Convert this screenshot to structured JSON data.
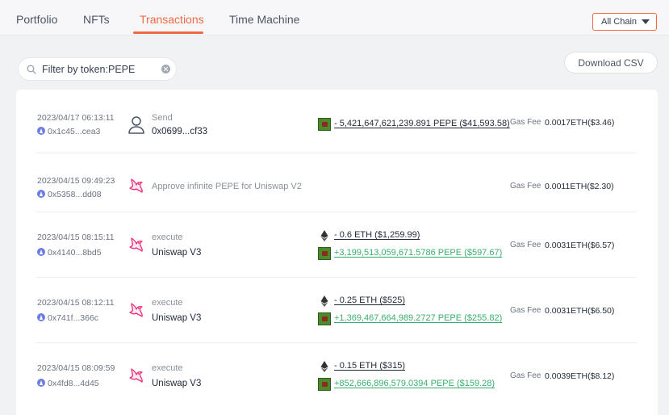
{
  "tabs": [
    {
      "label": "Portfolio"
    },
    {
      "label": "NFTs"
    },
    {
      "label": "Transactions"
    },
    {
      "label": "Time Machine"
    }
  ],
  "active_tab": "Transactions",
  "chain_select": {
    "value": "All Chain"
  },
  "filter": {
    "value": "Filter by token:PEPE"
  },
  "download_label": "Download CSV",
  "colors": {
    "accent": "#ef6a43",
    "positive": "#3aae6e"
  },
  "transactions": [
    {
      "time": "2023/04/17 06:13:11",
      "hash": "0x1c45...cea3",
      "type_icon": "user-icon",
      "type": "Send",
      "sub": "0x0699...cf33",
      "amounts": [
        {
          "token_icon": "pepe-token-icon",
          "text": "- 5,421,647,621,239.891 PEPE ($41,593.58)",
          "direction": "out"
        }
      ],
      "gas_label": "Gas Fee",
      "gas": "0.0017ETH($3.46)"
    },
    {
      "time": "2023/04/15 09:49:23",
      "hash": "0x5358...dd08",
      "type_icon": "uniswap-icon",
      "type": "Approve infinite PEPE for Uniswap V2",
      "sub": "",
      "amounts": [],
      "gas_label": "Gas Fee",
      "gas": "0.0011ETH($2.30)"
    },
    {
      "time": "2023/04/15 08:15:11",
      "hash": "0x4140...8bd5",
      "type_icon": "uniswap-icon",
      "type": "execute",
      "sub": "Uniswap V3",
      "amounts": [
        {
          "token_icon": "eth-token-icon",
          "text": "- 0.6 ETH ($1,259.99)",
          "direction": "out"
        },
        {
          "token_icon": "pepe-token-icon",
          "text": "+3,199,513,059,671.5786 PEPE ($597.67)",
          "direction": "in"
        }
      ],
      "gas_label": "Gas Fee",
      "gas": "0.0031ETH($6.57)"
    },
    {
      "time": "2023/04/15 08:12:11",
      "hash": "0x741f...366c",
      "type_icon": "uniswap-icon",
      "type": "execute",
      "sub": "Uniswap V3",
      "amounts": [
        {
          "token_icon": "eth-token-icon",
          "text": "- 0.25 ETH ($525)",
          "direction": "out"
        },
        {
          "token_icon": "pepe-token-icon",
          "text": "+1,369,467,664,989.2727 PEPE ($255.82)",
          "direction": "in"
        }
      ],
      "gas_label": "Gas Fee",
      "gas": "0.0031ETH($6.50)"
    },
    {
      "time": "2023/04/15 08:09:59",
      "hash": "0x4fd8...4d45",
      "type_icon": "uniswap-icon",
      "type": "execute",
      "sub": "Uniswap V3",
      "amounts": [
        {
          "token_icon": "eth-token-icon",
          "text": "- 0.15 ETH ($315)",
          "direction": "out"
        },
        {
          "token_icon": "pepe-token-icon",
          "text": "+852,666,896,579.0394 PEPE ($159.28)",
          "direction": "in"
        }
      ],
      "gas_label": "Gas Fee",
      "gas": "0.0039ETH($8.12)"
    }
  ]
}
